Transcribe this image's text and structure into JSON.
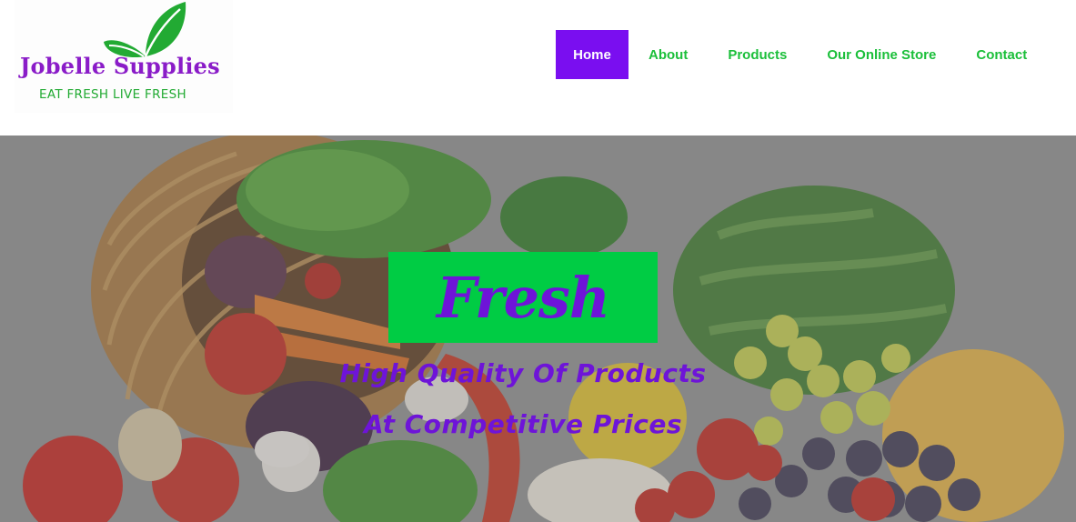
{
  "colors": {
    "brand_purple": "#7a0ef0",
    "brand_green": "#00cc44",
    "logo_purple": "#8a1cc8",
    "logo_green": "#22aa33",
    "nav_text_green": "#1bbf3a",
    "hero_text_purple": "#6e14d8"
  },
  "logo": {
    "name": "Jobelle Supplies",
    "tagline": "EAT FRESH LIVE FRESH",
    "icon": "leaves-icon"
  },
  "nav": {
    "items": [
      {
        "label": "Home",
        "active": true
      },
      {
        "label": "About",
        "active": false
      },
      {
        "label": "Products",
        "active": false
      },
      {
        "label": "Our Online Store",
        "active": false
      },
      {
        "label": "Contact",
        "active": false
      }
    ]
  },
  "hero": {
    "badge": "Fresh",
    "line1": "High Quality Of Products",
    "line2": "At Competitive Prices",
    "background_image": "vegetables-basket-image"
  }
}
